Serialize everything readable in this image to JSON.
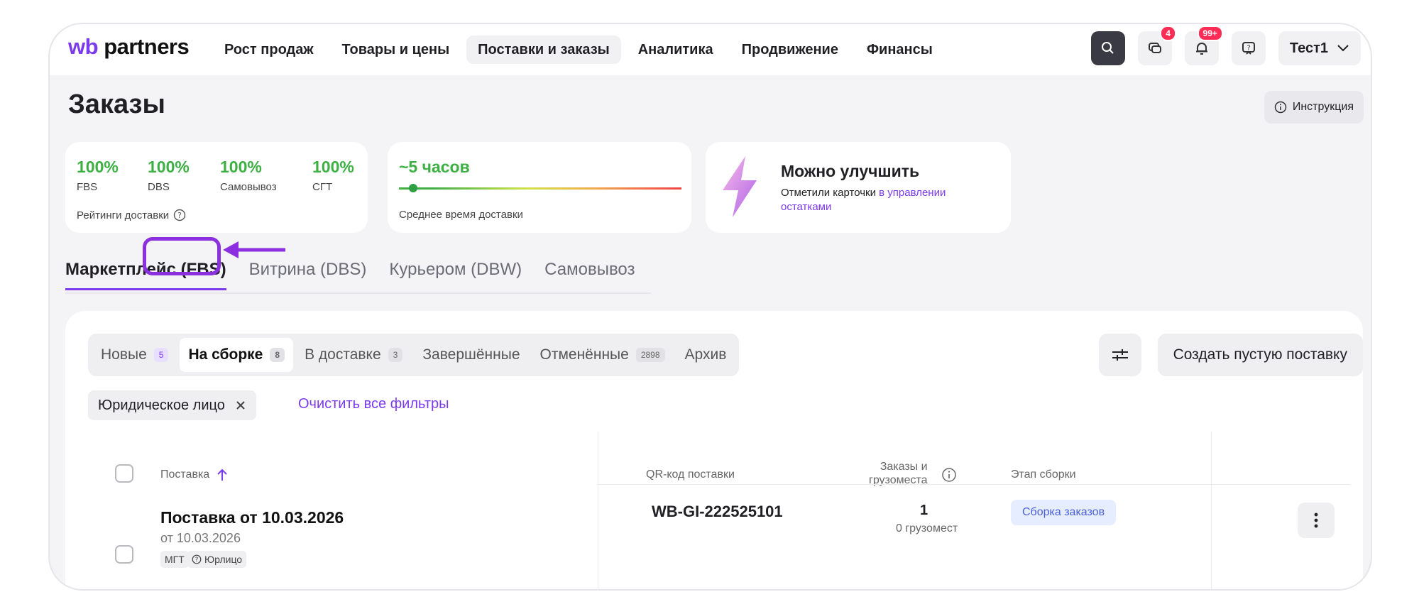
{
  "brand": {
    "logo_wb": "wb",
    "logo_partners": "partners"
  },
  "nav": [
    "Рост продаж",
    "Товары и цены",
    "Поставки и заказы",
    "Аналитика",
    "Продвижение",
    "Финансы"
  ],
  "header": {
    "chat_badge": "4",
    "notify_badge": "99+",
    "user": "Тест1"
  },
  "page": {
    "title": "Заказы",
    "instruction": "Инструкция"
  },
  "ratings": {
    "items": [
      {
        "value": "100%",
        "label": "FBS"
      },
      {
        "value": "100%",
        "label": "DBS"
      },
      {
        "value": "100%",
        "label": "Самовывоз"
      },
      {
        "value": "100%",
        "label": "СГТ"
      }
    ],
    "caption": "Рейтинги доставки"
  },
  "delivery_time": {
    "value": "~5 часов",
    "caption": "Среднее время доставки"
  },
  "improve": {
    "title": "Можно улучшить",
    "text": "Отметили карточки ",
    "link": "в управлении остатками"
  },
  "tabs": [
    "Маркетплейс (FBS)",
    "Витрина (DBS)",
    "Курьером (DBW)",
    "Самовывоз"
  ],
  "status_tabs": [
    {
      "label": "Новые",
      "count": "5"
    },
    {
      "label": "На сборке",
      "count": "8"
    },
    {
      "label": "В доставке",
      "count": "3"
    },
    {
      "label": "Завершённые",
      "count": ""
    },
    {
      "label": "Отменённые",
      "count": "2898"
    },
    {
      "label": "Архив",
      "count": ""
    }
  ],
  "actions": {
    "create": "Создать пустую поставку"
  },
  "filter_chip": "Юридическое лицо",
  "clear_filters": "Очистить все фильтры",
  "table": {
    "headers": {
      "supply": "Поставка",
      "qr": "QR-код поставки",
      "orders_l1": "Заказы и",
      "orders_l2": "грузоместа",
      "stage": "Этап сборки"
    },
    "row": {
      "title": "Поставка от 10.03.2026",
      "date": "от 10.03.2026",
      "tag1": "МГТ",
      "tag2": "Юрлицо",
      "qr": "WB-GI-222525101",
      "orders": "1",
      "places": "0 грузомест",
      "stage": "Сборка заказов"
    }
  },
  "colors": {
    "accent": "#7c3aed",
    "green": "#3cb043",
    "highlight": "#8b2fe0"
  }
}
